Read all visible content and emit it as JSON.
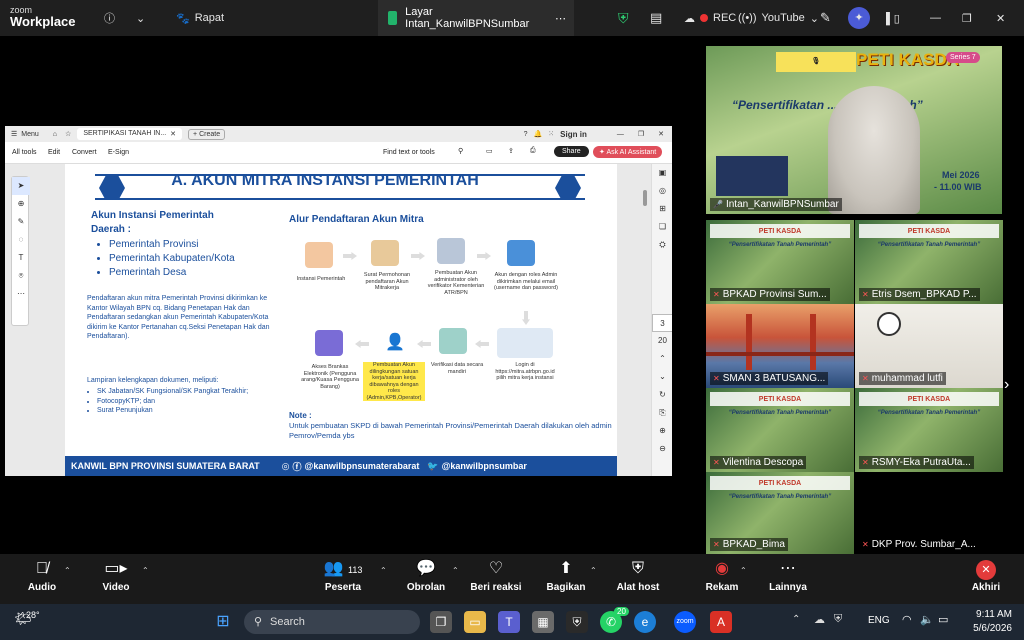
{
  "topbar": {
    "brand_line1": "zoom",
    "brand_line2": "Workplace",
    "meeting_label": "Rapat",
    "active_tab": "Layar Intan_KanwilBPNSumbar",
    "rec_label": "REC",
    "youtube_label": "YouTube"
  },
  "shared_window": {
    "menu_label": "Menu",
    "tab_title": "SERTIPIKASI TANAH IN...",
    "create_label": "Create",
    "sign_in": "Sign in",
    "toolbar_items": [
      "All tools",
      "Edit",
      "Convert",
      "E-Sign"
    ],
    "find_label": "Find text or tools",
    "share_label": "Share",
    "ai_label": "Ask AI Assistant",
    "page_number": "3",
    "page_total": "20",
    "slide": {
      "heading": "A. AKUN MITRA INSTANSI PEMERINTAH",
      "left_title_1": "Akun Instansi Pemerintah",
      "left_title_2": "Daerah :",
      "bullets": [
        "Pemerintah Provinsi",
        "Pemerintah Kabupaten/Kota",
        "Pemerintah Desa"
      ],
      "para1": "Pendaftaran akun mitra Pemerintah Provinsi dikirimkan ke Kantor Wilayah BPN cq. Bidang Penetapan Hak dan Pendaftaran sedangkan akun Pemerintah Kabupaten/Kota dikirim ke Kantor Pertanahan cq.Seksi Penetapan Hak dan Pendaftaran).",
      "lampiran_title": "Lampiran kelengkapan dokumen, meliputi:",
      "lampiran": [
        "SK Jabatan/SK Fungsional/SK Pangkat Terakhir;",
        "FotocopyKTP; dan",
        "Surat Penunjukan"
      ],
      "flow_title": "Alur Pendaftaran Akun Mitra",
      "flow_row1": [
        "Instansi Pemerintah",
        "Surat Permohonan pendaftaran Akun Mitrakerja",
        "Pembuatan Akun administrator oleh verifikator Kementerian ATR/BPN",
        "Akun dengan roles Admin dikirimkan melalui email (username dan password)"
      ],
      "flow_row2": [
        "Akses Brankas Elektronik (Pengguna arang/Kuasa Pengguna Barang)",
        "Pembuatan Akun dilingkungan satuan kerja/satuan kerja dibawahnya dengan roles (Admin,KPB,Operator)",
        "Verifikasi data secara mandiri",
        "Login di https://mitra.atrbpn.go.id pilih mitra kerja instansi"
      ],
      "note_title": "Note :",
      "note_text": "Untuk pembuatan SKPD di bawah Pemerintah Provinsi/Pemerintah Daerah dilakukan oleh admin Pemrov/Pemda ybs",
      "footer_left": "KANWIL BPN PROVINSI SUMATERA BARAT",
      "footer_social1": "@kanwilbpnsumaterabarat",
      "footer_social2": "@kanwilbpnsumbar"
    }
  },
  "speaker": {
    "banner_title": "PETI KASDA",
    "series": "Series 7",
    "subtitle": "“Pensertifikatan ... h Pemerintah”",
    "date_text": "Mei 2026",
    "time_text": "- 11.00 WIB",
    "name": "Intan_KanwilBPNSumbar"
  },
  "gallery": [
    {
      "name": "BPKAD Provinsi Sum...",
      "muted": true
    },
    {
      "name": "Etris Dsem_BPKAD P...",
      "muted": true
    },
    {
      "name": "SMAN 3 BATUSANG...",
      "muted": true
    },
    {
      "name": "muhammad lutfi",
      "muted": true
    },
    {
      "name": "Vilentina Descopa",
      "muted": true
    },
    {
      "name": "RSMY-Eka PutraUta...",
      "muted": true
    },
    {
      "name": "BPKAD_Bima",
      "muted": true
    },
    {
      "name": "DKP Prov. Sumbar_A...",
      "muted": true
    }
  ],
  "gallery_banner": "PETI KASDA",
  "gallery_sub": "“Pensertifikatan Tanah Pemerintah”",
  "bottombar": {
    "audio": "Audio",
    "video": "Video",
    "participants": "Peserta",
    "participant_count": "113",
    "chat": "Obrolan",
    "react": "Beri reaksi",
    "share": "Bagikan",
    "host_tools": "Alat host",
    "record": "Rekam",
    "more": "Lainnya",
    "end": "Akhiri"
  },
  "taskbar": {
    "temp": "28°",
    "search": "Search",
    "whatsapp_badge": "20",
    "lang": "ENG",
    "time": "9:11 AM",
    "date": "5/6/2026"
  },
  "colors": {
    "accent": "#1b4f9c",
    "danger": "#e33b3b",
    "zoom_blue": "#0b5cff"
  }
}
